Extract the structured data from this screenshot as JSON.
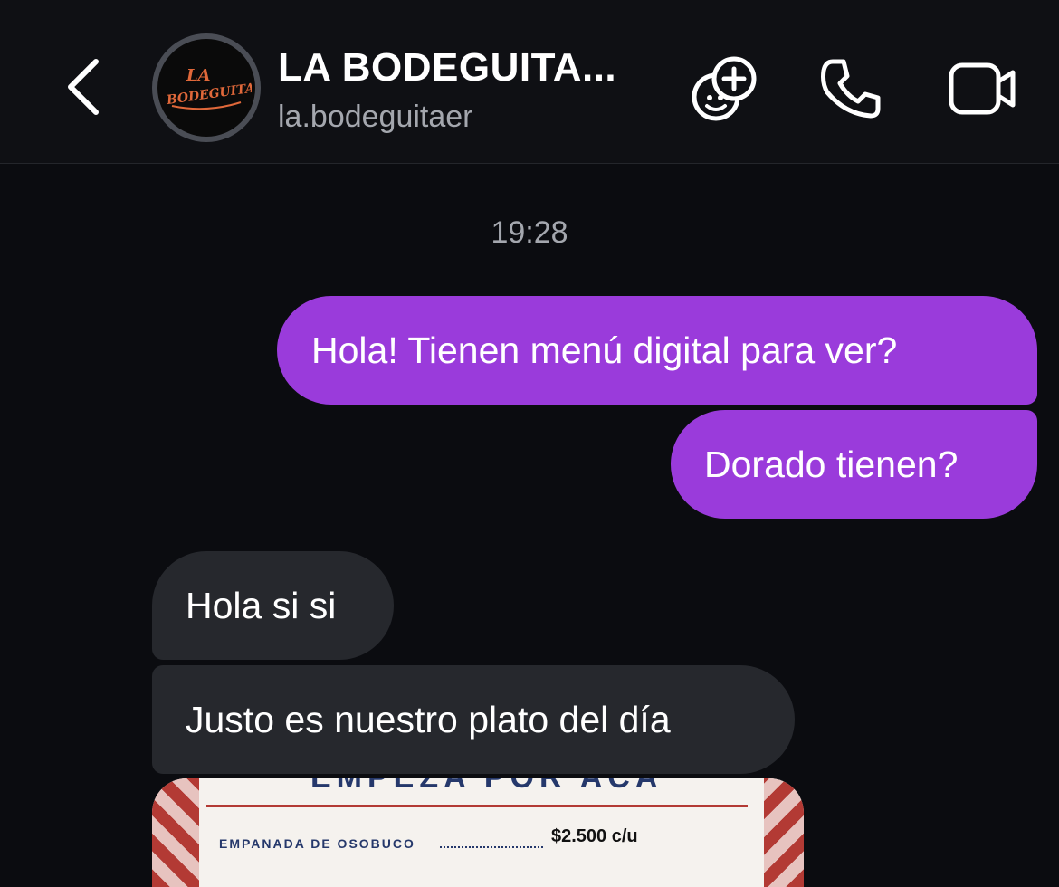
{
  "header": {
    "title": "LA BODEGUITA...",
    "username": "la.bodeguitaer",
    "avatar_logo_top": "LA",
    "avatar_logo_bottom": "BODEGUITA"
  },
  "icons": {
    "back": "chevron-left-icon",
    "add_people": "add-people-icon",
    "call": "phone-icon",
    "video": "video-camera-icon"
  },
  "colors": {
    "outgoing_bubble": "#9a3bdb",
    "incoming_bubble": "#26282d",
    "background": "#0b0c10"
  },
  "timestamp": "19:28",
  "messages": [
    {
      "direction": "outgoing",
      "text": "Hola! Tienen menú digital para ver?"
    },
    {
      "direction": "outgoing",
      "text": "Dorado tienen?"
    },
    {
      "direction": "incoming",
      "text": "Hola si si"
    },
    {
      "direction": "incoming",
      "text": "Justo es nuestro plato del día"
    }
  ],
  "menu_image": {
    "heading": "EMPEZA POR ACA",
    "item_name": "EMPANADA DE OSOBUCO",
    "item_price": "$2.500 c/u"
  }
}
